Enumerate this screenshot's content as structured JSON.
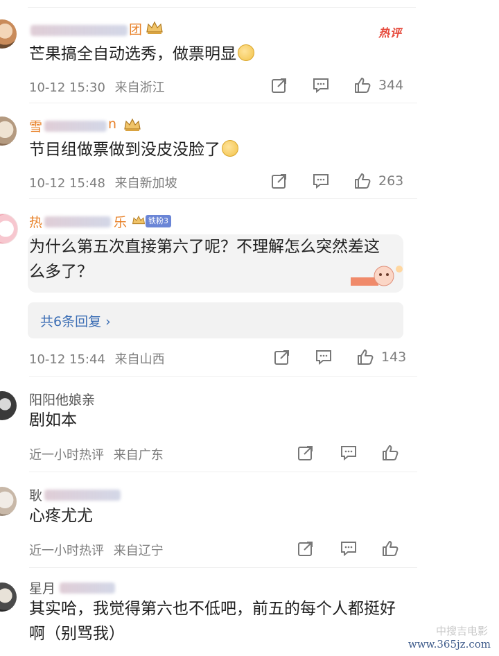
{
  "comments": [
    {
      "username": "",
      "username_suffix": "团",
      "hot_tag": "热评",
      "text": "芒果搞全自动选秀，做票明显",
      "date": "10-12 15:30",
      "location": "来自浙江",
      "likes": "344"
    },
    {
      "username": "雪",
      "username_suffix": "n",
      "text": "节目组做票做到没皮没脸了",
      "date": "10-12 15:48",
      "location": "来自新加坡",
      "likes": "263"
    },
    {
      "username": "热",
      "username_suffix": "乐",
      "fan_badge": "铁粉3",
      "text": "为什么第五次直接第六了呢？不理解怎么突然差这么多了？",
      "replies_label": "共6条回复 ›",
      "date": "10-12 15:44",
      "location": "来自山西",
      "likes": "143"
    },
    {
      "username": "阳阳他娘亲",
      "text": "剧如本",
      "time": "近一小时热评",
      "location": "来自广东"
    },
    {
      "username": "耿",
      "text": "心疼尤尤",
      "time": "近一小时热评",
      "location": "来自辽宁"
    },
    {
      "username": "星月",
      "text": "其实哈，我觉得第六也不低吧，前五的每个人都挺好啊（别骂我）"
    }
  ],
  "watermark": {
    "logo": "中搜吉电影",
    "url": "www.365jz.com"
  },
  "icons": [
    "share-icon",
    "comment-icon",
    "like-icon",
    "crown-icon",
    "emoji-icon"
  ],
  "colors": {
    "username_highlight": "#e8822a",
    "hot_tag": "#e64a3c",
    "reply_link": "#3d6fb5"
  }
}
